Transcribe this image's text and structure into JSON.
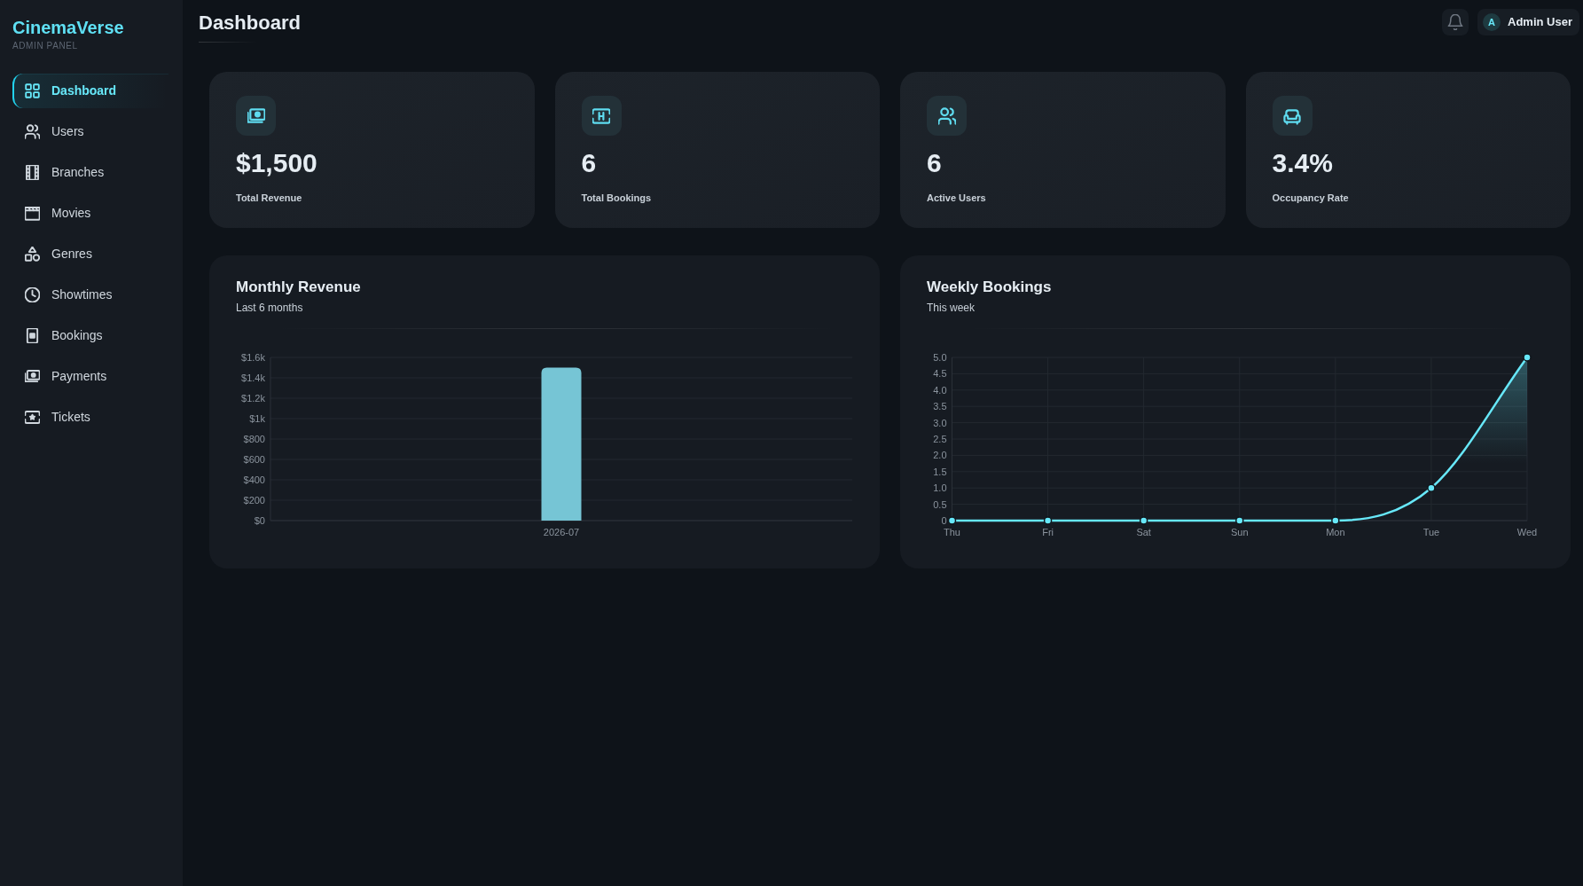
{
  "sidebar": {
    "brand": "CinemaVerse",
    "subtitle": "ADMIN PANEL",
    "items": [
      {
        "label": "Dashboard",
        "selected": true
      },
      {
        "label": "Users",
        "selected": false
      },
      {
        "label": "Branches",
        "selected": false
      },
      {
        "label": "Movies",
        "selected": false
      },
      {
        "label": "Genres",
        "selected": false
      },
      {
        "label": "Showtimes",
        "selected": false
      },
      {
        "label": "Bookings",
        "selected": false
      },
      {
        "label": "Payments",
        "selected": false
      },
      {
        "label": "Tickets",
        "selected": false
      }
    ]
  },
  "header": {
    "title": "Dashboard",
    "user": {
      "initial": "A",
      "name": "Admin User"
    }
  },
  "stats": [
    {
      "value": "$1,500",
      "label": "Total Revenue"
    },
    {
      "value": "6",
      "label": "Total Bookings"
    },
    {
      "value": "6",
      "label": "Active Users"
    },
    {
      "value": "3.4%",
      "label": "Occupancy Rate"
    }
  ],
  "panels": [
    {
      "title": "Monthly Revenue",
      "subtitle": "Last 6 months",
      "chart_data": {
        "type": "bar",
        "categories": [
          "2026-07"
        ],
        "series": [
          {
            "color": "#76c5d5",
            "values": [
              1500
            ]
          }
        ],
        "ylim": [
          0,
          1600
        ],
        "yticks": [
          {
            "value": 0,
            "label": "$0"
          },
          {
            "value": 200,
            "label": "$200"
          },
          {
            "value": 400,
            "label": "$400"
          },
          {
            "value": 600,
            "label": "$600"
          },
          {
            "value": 800,
            "label": "$800"
          },
          {
            "value": 1000,
            "label": "$1k"
          },
          {
            "value": 1200,
            "label": "$1.2k"
          },
          {
            "value": 1400,
            "label": "$1.4k"
          },
          {
            "value": 1600,
            "label": "$1.6k"
          }
        ],
        "grid": true
      }
    },
    {
      "title": "Weekly Bookings",
      "subtitle": "This week",
      "chart_data": {
        "type": "area",
        "categories": [
          "Thu",
          "Fri",
          "Sat",
          "Sun",
          "Mon",
          "Tue",
          "Wed"
        ],
        "series": [
          {
            "color": "#67e8f9",
            "values": [
              0,
              0,
              0,
              0,
              0,
              1,
              5
            ]
          }
        ],
        "ylim": [
          0,
          5
        ],
        "yticks": [
          {
            "value": 0,
            "label": "0"
          },
          {
            "value": 0.5,
            "label": "0.5"
          },
          {
            "value": 1,
            "label": "1.0"
          },
          {
            "value": 1.5,
            "label": "1.5"
          },
          {
            "value": 2,
            "label": "2.0"
          },
          {
            "value": 2.5,
            "label": "2.5"
          },
          {
            "value": 3,
            "label": "3.0"
          },
          {
            "value": 3.5,
            "label": "3.5"
          },
          {
            "value": 4,
            "label": "4.0"
          },
          {
            "value": 4.5,
            "label": "4.5"
          },
          {
            "value": 5,
            "label": "5.0"
          }
        ],
        "grid": true
      }
    }
  ]
}
